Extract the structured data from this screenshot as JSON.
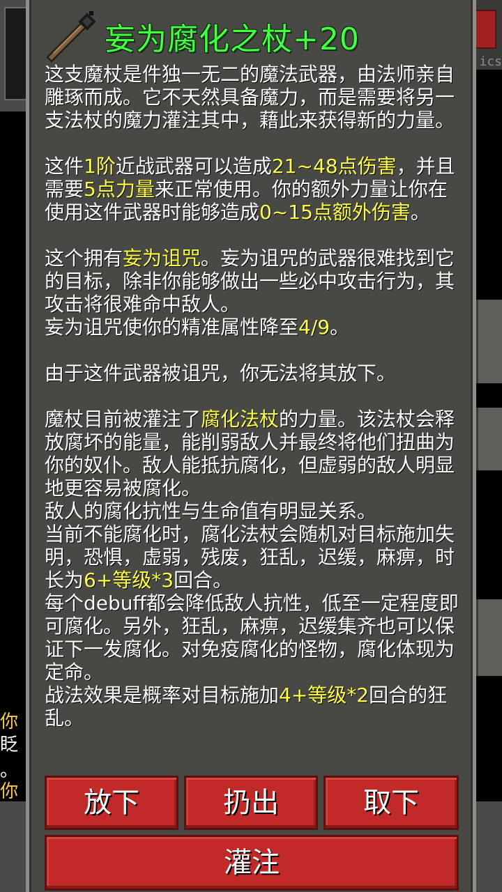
{
  "item": {
    "title": "妄为腐化之杖+20",
    "icon": "wand-icon"
  },
  "description": {
    "intro": "这支魔杖是件独一无二的魔法武器，由法师亲自雕琢而成。它不天然具备魔力，而是需要将另一支法杖的魔力灌注其中，藉此来获得新的力量。",
    "stats": {
      "t1": "这件",
      "tier": "1阶",
      "t2": "近战武器可以造成",
      "damage": "21~48点伤害",
      "t3": "，并且需要",
      "strength": "5点力量",
      "t4": "来正常使用。你的额外力量让你在使用这件武器时能够造成",
      "bonus": "0~15点额外伤害",
      "t5": "。"
    },
    "curse": {
      "t1": "这个拥有",
      "name": "妄为诅咒",
      "t2": "。妄为诅咒的武器很难找到它的目标，除非你能够做出一些必中攻击行为，其攻击将很难命中敌人。",
      "t3": "妄为诅咒使你的精准属性降至",
      "accuracy": "4/9",
      "t4": "。"
    },
    "cursed_note": "由于这件武器被诅咒，你无法将其放下。",
    "imbue": {
      "t1": "魔杖目前被灌注了",
      "wand": "腐化法杖",
      "t2": "的力量。该法杖会释放腐坏的能量，能削弱敌人并最终将他们扭曲为你的奴仆。敌人能抵抗腐化，但虚弱的敌人明显地更容易被腐化。",
      "t3": "敌人的腐化抗性与生命值有明显关系。",
      "t4": "当前不能腐化时，腐化法杖会随机对目标施加失明，恐惧，虚弱，残废，狂乱，迟缓，麻痹，时长为",
      "duration": "6+等级*3",
      "t5": "回合。",
      "t6": "每个debuff都会降低敌人抗性，低至一定程度即可腐化。另外，狂乱，麻痹，迟缓集齐也可以保证下一发腐化。对免疫腐化的怪物，腐化体现为定命。",
      "t7": "战法效果是概率对目标施加",
      "battle": "4+等级*2",
      "t8": "回合的狂乱。"
    }
  },
  "buttons": {
    "drop": "放下",
    "throw": "扔出",
    "unequip": "取下",
    "imbue": "灌注"
  },
  "background": {
    "right_label": "ics",
    "log_lines": [
      {
        "text": "你",
        "color": "#ffcc33"
      },
      {
        "text": "眨",
        "color": "#ffffff"
      },
      {
        "text": "。",
        "color": "#ffffff"
      },
      {
        "text": "你",
        "color": "#ffcc33"
      }
    ]
  }
}
